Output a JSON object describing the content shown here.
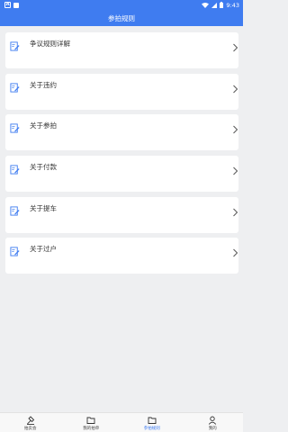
{
  "status_bar": {
    "time": "9:43",
    "left_icon_a": "A",
    "icons": [
      "notification-a-icon",
      "notification-square-icon",
      "wifi-icon",
      "signal-icon",
      "battery-icon"
    ]
  },
  "header": {
    "title": "参拍规则"
  },
  "rules": [
    {
      "label": "争议规则详解",
      "icon": "edit-document-icon"
    },
    {
      "label": "关于违约",
      "icon": "edit-document-icon"
    },
    {
      "label": "关于参拍",
      "icon": "edit-document-icon"
    },
    {
      "label": "关于付款",
      "icon": "edit-document-icon"
    },
    {
      "label": "关于提车",
      "icon": "edit-document-icon"
    },
    {
      "label": "关于过户",
      "icon": "edit-document-icon"
    }
  ],
  "tabs": [
    {
      "label": "拍卖会",
      "icon": "auction-hammer-icon",
      "active": false
    },
    {
      "label": "我的拍单",
      "icon": "folder-icon",
      "active": false
    },
    {
      "label": "参拍规则",
      "icon": "folder-icon",
      "active": true
    },
    {
      "label": "我的",
      "icon": "user-icon",
      "active": false
    }
  ],
  "colors": {
    "primary": "#3f7cf0",
    "background": "#eeeff1",
    "card": "#ffffff"
  }
}
